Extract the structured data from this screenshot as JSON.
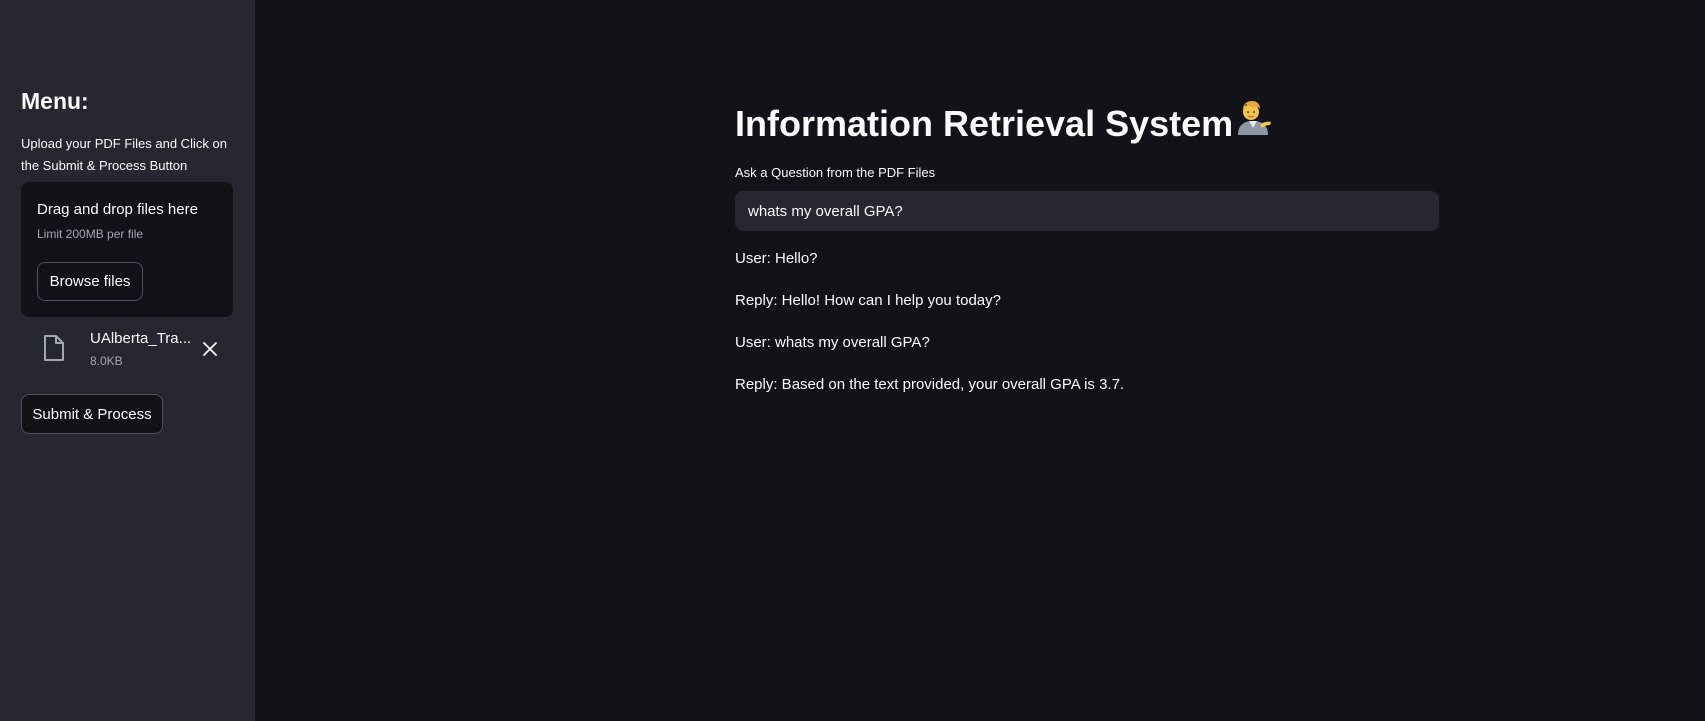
{
  "sidebar": {
    "title": "Menu:",
    "description": "Upload your PDF Files and Click on the Submit & Process Button",
    "uploader": {
      "dropzone_title": "Drag and drop files here",
      "limit_text": "Limit 200MB per file",
      "browse_label": "Browse files"
    },
    "file": {
      "name": "UAlberta_Tra...",
      "size": "8.0KB",
      "icon": "file-icon"
    },
    "submit_label": "Submit & Process"
  },
  "main": {
    "title": "Information Retrieval System",
    "title_emoji": "person-tipping-hand-emoji",
    "question_label": "Ask a Question from the PDF Files",
    "question_value": "whats my overall GPA?",
    "messages": [
      "User: Hello?",
      "Reply: Hello! How can I help you today?",
      "User: whats my overall GPA?",
      "Reply: Based on the text provided, your overall GPA is 3.7."
    ]
  },
  "colors": {
    "sidebar_bg": "#262730",
    "main_bg": "#121318",
    "input_bg": "#262730",
    "text": "#fafafa",
    "muted_text": "#a3a8b4"
  }
}
